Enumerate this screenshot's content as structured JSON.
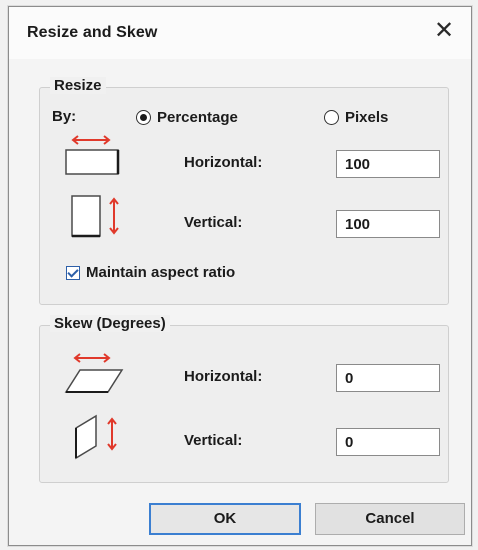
{
  "window": {
    "title": "Resize and Skew",
    "close_glyph": "✕"
  },
  "resize": {
    "group_label": "Resize",
    "by_label": "By:",
    "percentage_label": "Percentage",
    "pixels_label": "Pixels",
    "percentage_selected": true,
    "horizontal_label": "Horizontal:",
    "horizontal_value": "100",
    "vertical_label": "Vertical:",
    "vertical_value": "100",
    "maintain_aspect_label": "Maintain aspect ratio",
    "maintain_aspect_checked": true
  },
  "skew": {
    "group_label": "Skew (Degrees)",
    "horizontal_label": "Horizontal:",
    "horizontal_value": "0",
    "vertical_label": "Vertical:",
    "vertical_value": "0"
  },
  "buttons": {
    "ok_label": "OK",
    "cancel_label": "Cancel"
  },
  "colors": {
    "arrow_red": "#e0392b",
    "focus_blue": "#3b7fd1"
  },
  "icons": {
    "resize_horizontal": "resize-horizontal-icon",
    "resize_vertical": "resize-vertical-icon",
    "skew_horizontal": "skew-horizontal-icon",
    "skew_vertical": "skew-vertical-icon"
  }
}
